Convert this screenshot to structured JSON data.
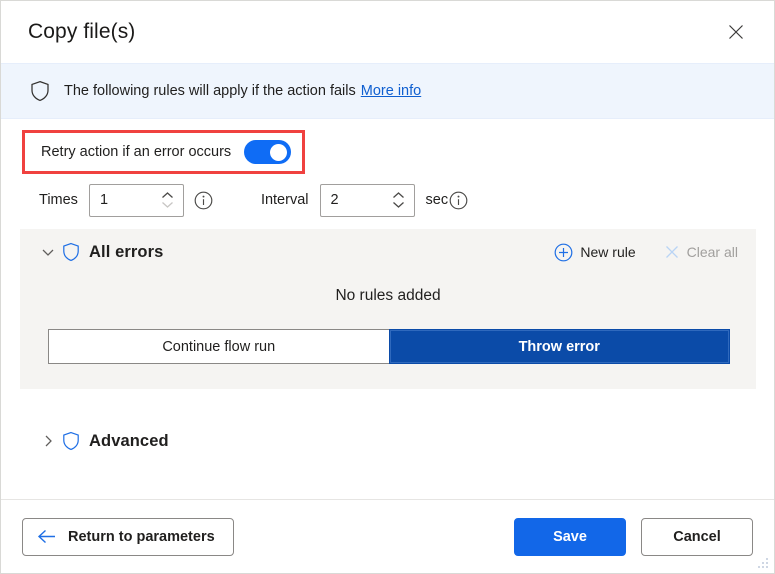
{
  "window": {
    "title": "Copy file(s)",
    "close_label": "×",
    "close_icon": "close-icon",
    "resize_grip_icon": "resize-grip-icon"
  },
  "banner": {
    "shield_icon": "shield-icon",
    "text": "The following rules will apply if the action fails",
    "link_label": "More info"
  },
  "retry": {
    "label": "Retry action if an error occurs",
    "toggle_state": "on",
    "highlight_color": "#f0413f",
    "toggle_color": "#0f6cf5"
  },
  "times": {
    "label": "Times",
    "value": "1",
    "info_icon": "info-icon",
    "up_icon": "chevron-up-icon",
    "down_icon": "chevron-down-icon"
  },
  "interval": {
    "label": "Interval",
    "value": "2",
    "unit": "sec",
    "info_icon": "info-icon",
    "up_icon": "chevron-up-icon",
    "down_icon": "chevron-down-icon"
  },
  "all_errors": {
    "expand_icon": "chevron-down-icon",
    "shield_icon": "shield-icon",
    "title": "All errors",
    "new_rule_label": "New rule",
    "new_rule_icon": "circle-plus-icon",
    "clear_all_label": "Clear all",
    "clear_all_icon": "close-x-icon",
    "clear_all_disabled": true,
    "empty_text": "No rules added",
    "options": [
      {
        "label": "Continue flow run",
        "selected": false
      },
      {
        "label": "Throw error",
        "selected": true
      }
    ],
    "selected_color": "#0b4ba8"
  },
  "advanced": {
    "expand_icon": "chevron-right-icon",
    "shield_icon": "shield-icon",
    "title": "Advanced"
  },
  "footer": {
    "return_label": "Return to parameters",
    "return_icon": "arrow-left-icon",
    "save_label": "Save",
    "cancel_label": "Cancel",
    "save_color": "#1267e8"
  }
}
